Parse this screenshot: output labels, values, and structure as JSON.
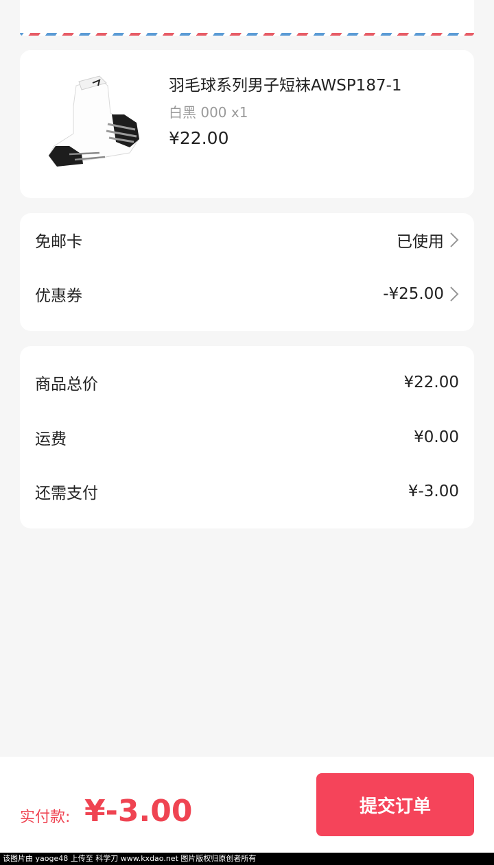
{
  "product": {
    "title": "羽毛球系列男子短袜AWSP187-1",
    "spec": "白黑 000 x1",
    "price": "¥22.00",
    "image_icon": "sock-image"
  },
  "discounts": {
    "free_shipping": {
      "label": "免邮卡",
      "value": "已使用"
    },
    "coupon": {
      "label": "优惠券",
      "value": "-¥25.00"
    }
  },
  "summary": {
    "subtotal": {
      "label": "商品总价",
      "value": "¥22.00"
    },
    "shipping": {
      "label": "运费",
      "value": "¥0.00"
    },
    "remaining": {
      "label": "还需支付",
      "value": "¥-3.00"
    }
  },
  "footer": {
    "pay_label": "实付款:",
    "pay_amount": "¥-3.00",
    "submit_label": "提交订单"
  },
  "watermark": "该图片由 yaoge48 上传至 科学刀 www.kxdao.net 图片版权归原创者所有",
  "colors": {
    "accent": "#ef4452",
    "button": "#f5445a",
    "background": "#f6f6f6"
  }
}
